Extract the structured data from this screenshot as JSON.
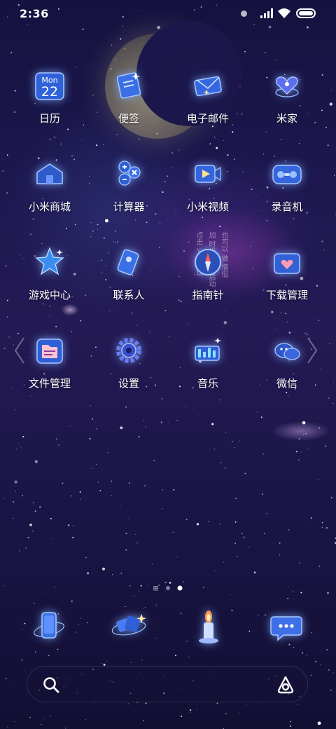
{
  "status": {
    "time": "2:36"
  },
  "apps": [
    {
      "label": "日历",
      "icon": "calendar-icon",
      "weekday": "Mon",
      "day": "22"
    },
    {
      "label": "便签",
      "icon": "notes-icon"
    },
    {
      "label": "电子邮件",
      "icon": "email-icon"
    },
    {
      "label": "米家",
      "icon": "mijia-icon"
    },
    {
      "label": "小米商城",
      "icon": "mi-store-icon"
    },
    {
      "label": "计算器",
      "icon": "calculator-icon"
    },
    {
      "label": "小米视频",
      "icon": "video-icon"
    },
    {
      "label": "录音机",
      "icon": "recorder-icon"
    },
    {
      "label": "游戏中心",
      "icon": "game-center-icon"
    },
    {
      "label": "联系人",
      "icon": "contacts-icon"
    },
    {
      "label": "指南针",
      "icon": "compass-icon"
    },
    {
      "label": "下载管理",
      "icon": "download-manager-icon"
    },
    {
      "label": "文件管理",
      "icon": "file-manager-icon"
    },
    {
      "label": "设置",
      "icon": "settings-icon"
    },
    {
      "label": "音乐",
      "icon": "music-icon"
    },
    {
      "label": "微信",
      "icon": "wechat-icon"
    }
  ],
  "dock": [
    {
      "icon": "phone-icon"
    },
    {
      "icon": "themes-icon"
    },
    {
      "icon": "candle-icon"
    },
    {
      "icon": "messages-icon"
    }
  ],
  "pager": {
    "pages": 3,
    "current": 3
  },
  "search": {
    "left_icon": "search-icon",
    "right_icon": "assistant-icon"
  },
  "wallpaper_hint": {
    "col1": "点击 > 也可以",
    "col2": "加 时光 音乐 启动",
    "col3": "也可以 做 情侣"
  },
  "colors": {
    "bg_top": "#15123f",
    "bg_bottom": "#120f33",
    "icon_glow": "#6fa8ff",
    "moon": "#e6dc96"
  }
}
